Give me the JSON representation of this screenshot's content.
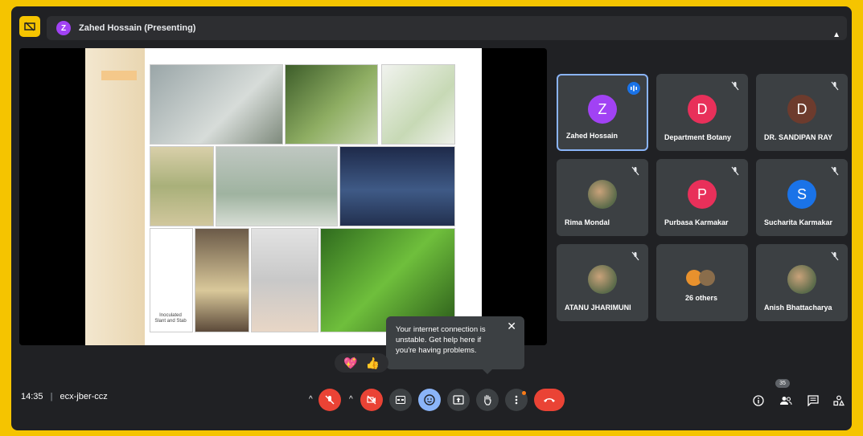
{
  "top": {
    "presenter_initial": "Z",
    "presenter_label": "Zahed Hossain (Presenting)"
  },
  "slide": {
    "caption_line1": "Inoculated",
    "caption_line2": "Slant and Stab"
  },
  "participants": [
    {
      "initial": "Z",
      "name": "Zahed Hossain",
      "color": "#a142f4",
      "speaking": true
    },
    {
      "initial": "D",
      "name": "Department Botany",
      "color": "#e8305a",
      "muted": true
    },
    {
      "initial": "D",
      "name": "DR. SANDIPAN RAY",
      "color": "#6d3b2d",
      "muted": true
    },
    {
      "initial": "",
      "name": "Rima Mondal",
      "photo": true,
      "muted": true
    },
    {
      "initial": "P",
      "name": "Purbasa Karmakar",
      "color": "#e8305a",
      "muted": true
    },
    {
      "initial": "S",
      "name": "Sucharita Karmakar",
      "color": "#1a73e8",
      "muted": true
    },
    {
      "initial": "",
      "name": "ATANU JHARIMUNI",
      "photo": true,
      "muted": true
    },
    {
      "initial": "",
      "name": "26 others",
      "group": true
    },
    {
      "initial": "",
      "name": "Anish Bhattacharya",
      "photo": true,
      "muted": true
    }
  ],
  "tooltip": {
    "text": "Your internet connection is unstable. Get help here if you're having problems.",
    "close": "✕"
  },
  "reactions": [
    "💖",
    "👍"
  ],
  "bottom": {
    "time": "14:35",
    "separator": "|",
    "meeting_code": "ecx-jber-ccz",
    "participant_count": "35"
  },
  "colors": {
    "accent": "#f5c400",
    "end_call": "#ea4335",
    "active_border": "#8ab4f8"
  }
}
